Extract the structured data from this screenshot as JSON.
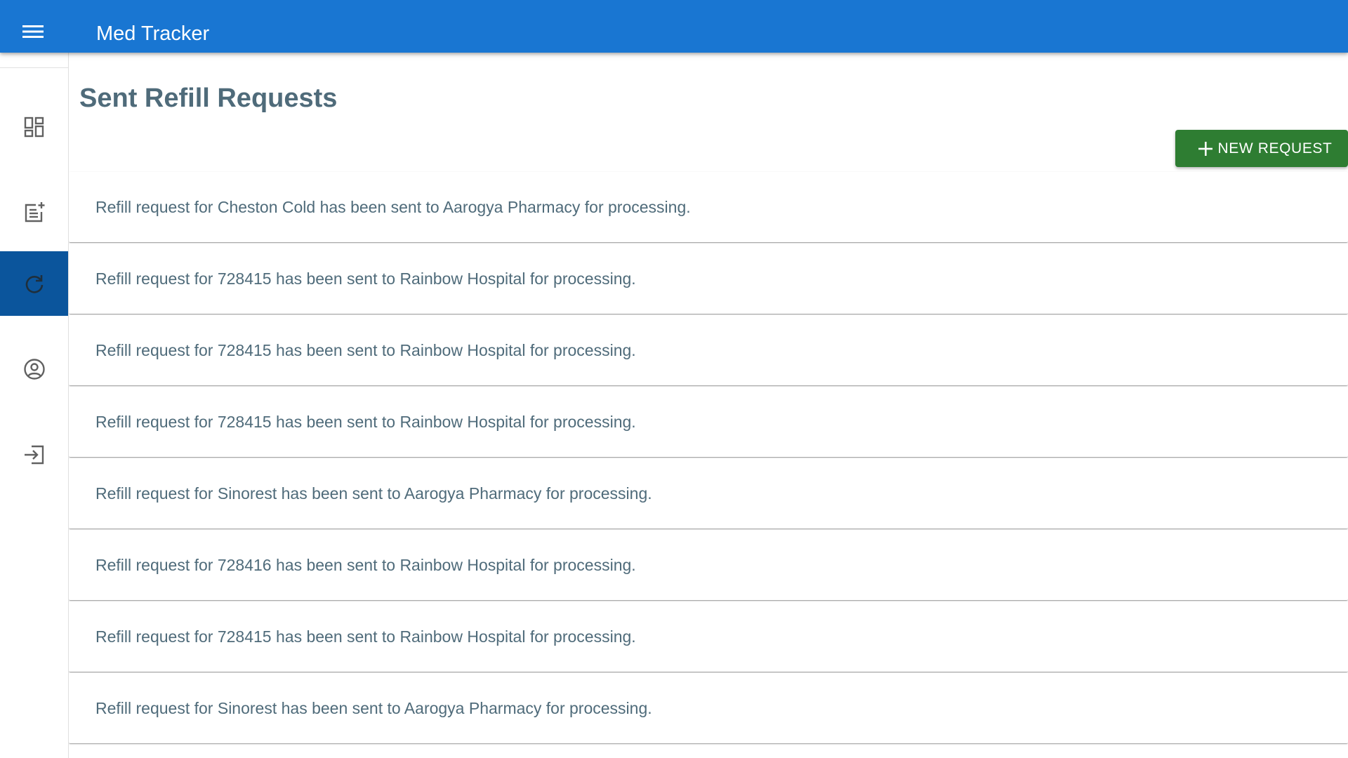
{
  "header": {
    "app_title": "Med Tracker",
    "menu_icon": "menu-icon",
    "color": "#1976d2"
  },
  "sidebar": {
    "items": [
      {
        "name": "dashboard",
        "icon": "dashboard-icon",
        "active": false
      },
      {
        "name": "add-prescription",
        "icon": "post-add-icon",
        "active": false
      },
      {
        "name": "refill-requests",
        "icon": "refresh-icon",
        "active": true
      },
      {
        "name": "profile",
        "icon": "account-circle-icon",
        "active": false
      },
      {
        "name": "logout",
        "icon": "logout-icon",
        "active": false
      }
    ],
    "active_color": "#0b559c"
  },
  "main": {
    "title": "Sent Refill Requests",
    "new_request_label": "NEW REQUEST",
    "new_request_color": "#2e7d32",
    "requests": [
      "Refill request for Cheston Cold has been sent to Aarogya Pharmacy for processing.",
      "Refill request for 728415 has been sent to Rainbow Hospital for processing.",
      "Refill request for 728415 has been sent to Rainbow Hospital for processing.",
      "Refill request for 728415 has been sent to Rainbow Hospital for processing.",
      "Refill request for Sinorest has been sent to Aarogya Pharmacy for processing.",
      "Refill request for 728416 has been sent to Rainbow Hospital for processing.",
      "Refill request for 728415 has been sent to Rainbow Hospital for processing.",
      "Refill request for Sinorest has been sent to Aarogya Pharmacy for processing."
    ]
  }
}
